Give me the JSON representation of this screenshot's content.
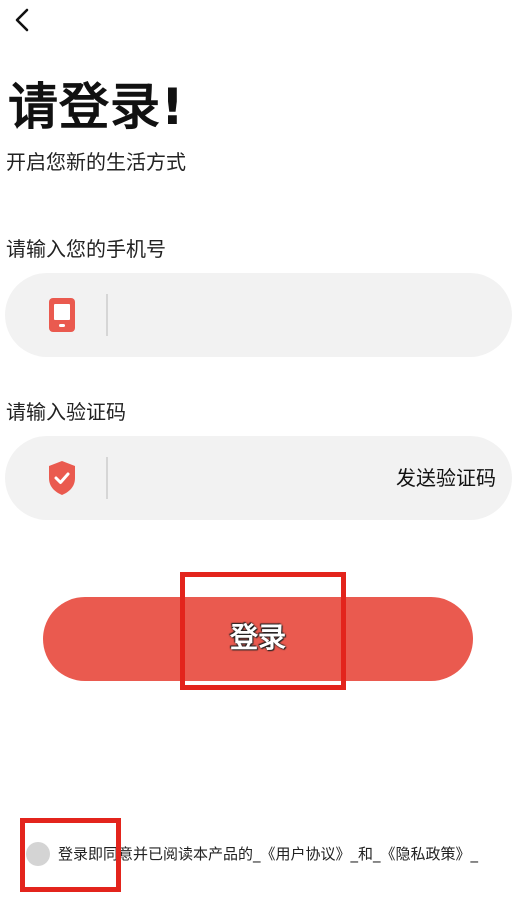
{
  "header": {
    "back_icon": "chevron-left-icon"
  },
  "title": "请登录!",
  "subtitle": "开启您新的生活方式",
  "phone": {
    "label": "请输入您的手机号",
    "icon": "phone-icon",
    "value": "",
    "placeholder": ""
  },
  "code": {
    "label": "请输入验证码",
    "icon": "shield-check-icon",
    "value": "",
    "placeholder": "",
    "send_label": "发送验证码"
  },
  "login_button": {
    "label": "登录"
  },
  "agreement": {
    "checked": false,
    "prefix": "登录即同意并已阅读本产品的",
    "user_agreement": "_《用户协议》_",
    "connector": "和",
    "privacy_policy": "_《隐私政策》_"
  },
  "colors": {
    "accent": "#ea5a4f",
    "highlight_box": "#e3241c",
    "field_bg": "#f2f2f2",
    "radio": "#d4d4d4"
  }
}
